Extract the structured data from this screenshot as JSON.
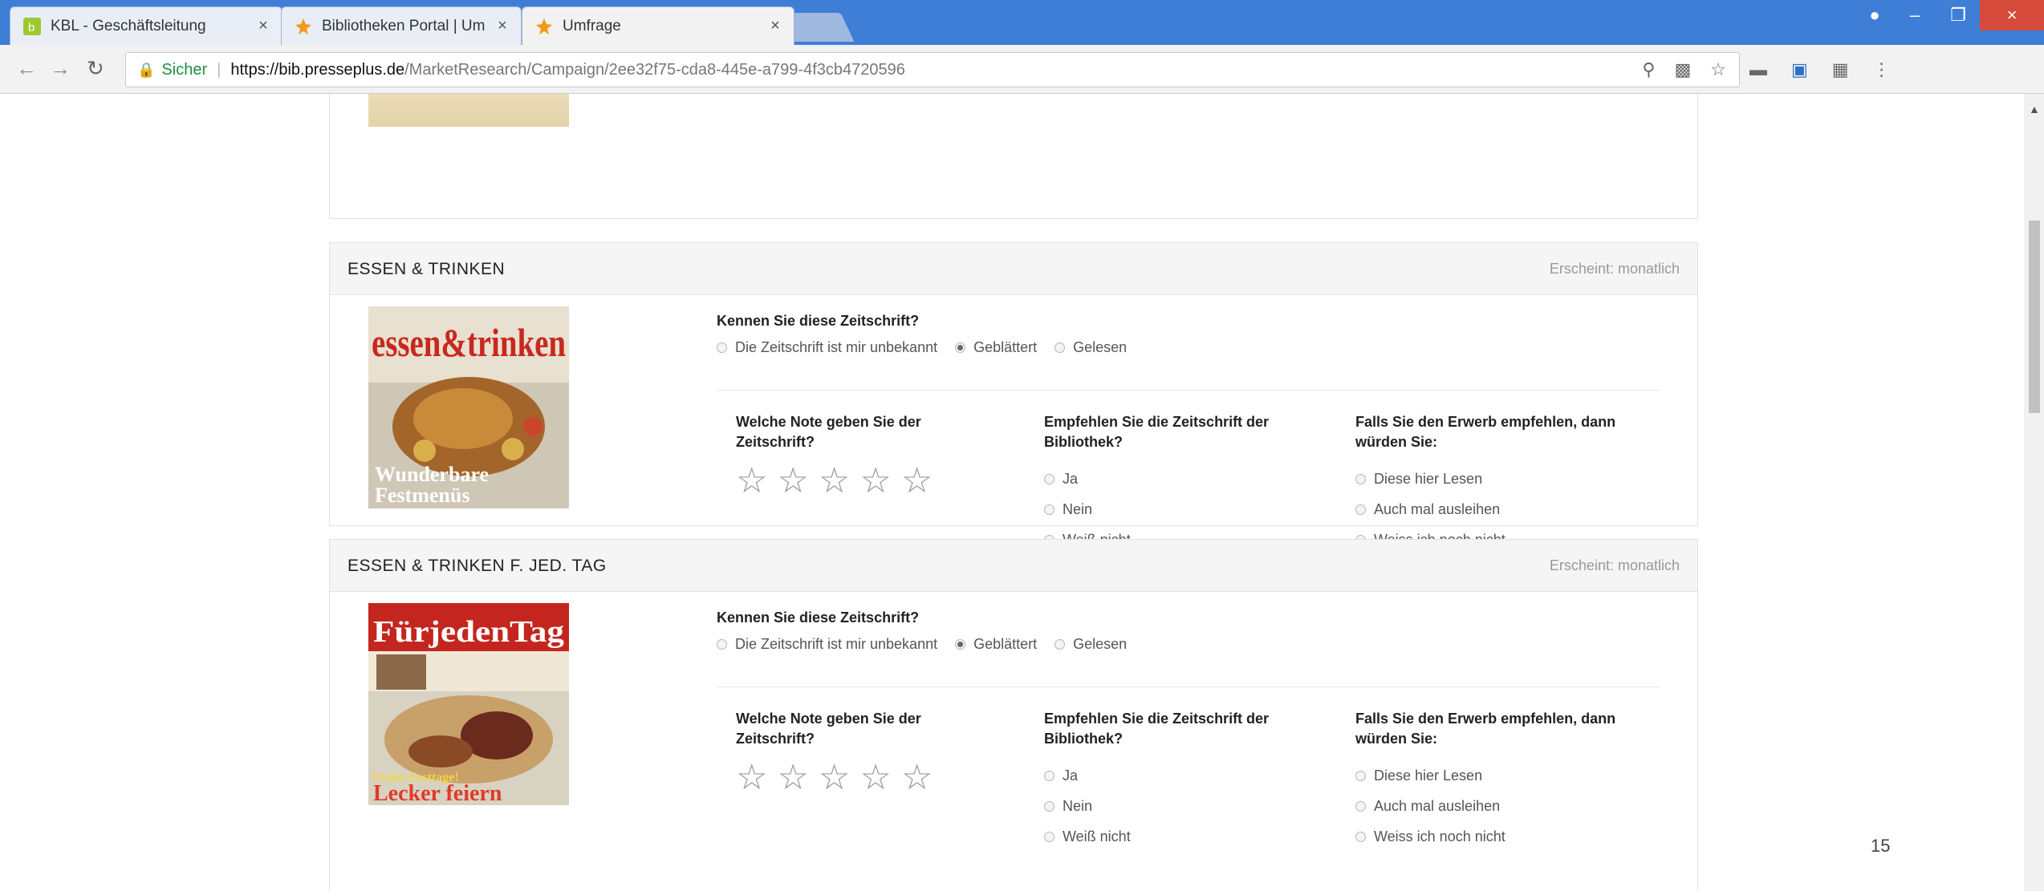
{
  "browser": {
    "tabs": [
      {
        "title": "KBL - Geschäftsleitung",
        "active": false
      },
      {
        "title": "Bibliotheken Portal | Um",
        "active": false
      },
      {
        "title": "Umfrage",
        "active": true
      }
    ],
    "address": {
      "secure_label": "Sicher",
      "url_host": "https://bib.presseplus.de",
      "url_path": "/MarketResearch/Campaign/2ee32f75-cda8-445e-a799-4f3cb4720596"
    }
  },
  "survey": {
    "magazines": [
      {
        "title": "ESSEN & TRINKEN",
        "frequency": "Erscheint: monatlich",
        "cover": {
          "masthead": "essen&trinken",
          "headline1": "Wunderbare",
          "headline2": "Festmenüs"
        },
        "known_question": "Kennen Sie diese Zeitschrift?",
        "known_options": [
          "Die Zeitschrift ist mir unbekannt",
          "Geblättert",
          "Gelesen"
        ],
        "known_selected": "Geblättert",
        "rating_question": "Welche Note geben Sie der Zeitschrift?",
        "rating_value": 0,
        "rating_max": 5,
        "recommend_question": "Empfehlen Sie die Zeitschrift der Bibliothek?",
        "recommend_options": [
          "Ja",
          "Nein",
          "Weiß nicht"
        ],
        "acquire_question": "Falls Sie den Erwerb empfehlen, dann würden Sie:",
        "acquire_options": [
          "Diese hier Lesen",
          "Auch mal ausleihen",
          "Weiss ich noch nicht"
        ]
      },
      {
        "title": "ESSEN & TRINKEN F. JED. TAG",
        "frequency": "Erscheint: monatlich",
        "cover": {
          "masthead": "FürjedenTag",
          "headline1": "Frohe Festtage!",
          "headline2": "Lecker feiern"
        },
        "known_question": "Kennen Sie diese Zeitschrift?",
        "known_options": [
          "Die Zeitschrift ist mir unbekannt",
          "Geblättert",
          "Gelesen"
        ],
        "known_selected": "Geblättert",
        "rating_question": "Welche Note geben Sie der Zeitschrift?",
        "rating_value": 0,
        "rating_max": 5,
        "recommend_question": "Empfehlen Sie die Zeitschrift der Bibliothek?",
        "recommend_options": [
          "Ja",
          "Nein",
          "Weiß nicht"
        ],
        "acquire_question": "Falls Sie den Erwerb empfehlen, dann würden Sie:",
        "acquire_options": [
          "Diese hier Lesen",
          "Auch mal ausleihen",
          "Weiss ich noch nicht"
        ]
      }
    ]
  },
  "page_number": "15"
}
